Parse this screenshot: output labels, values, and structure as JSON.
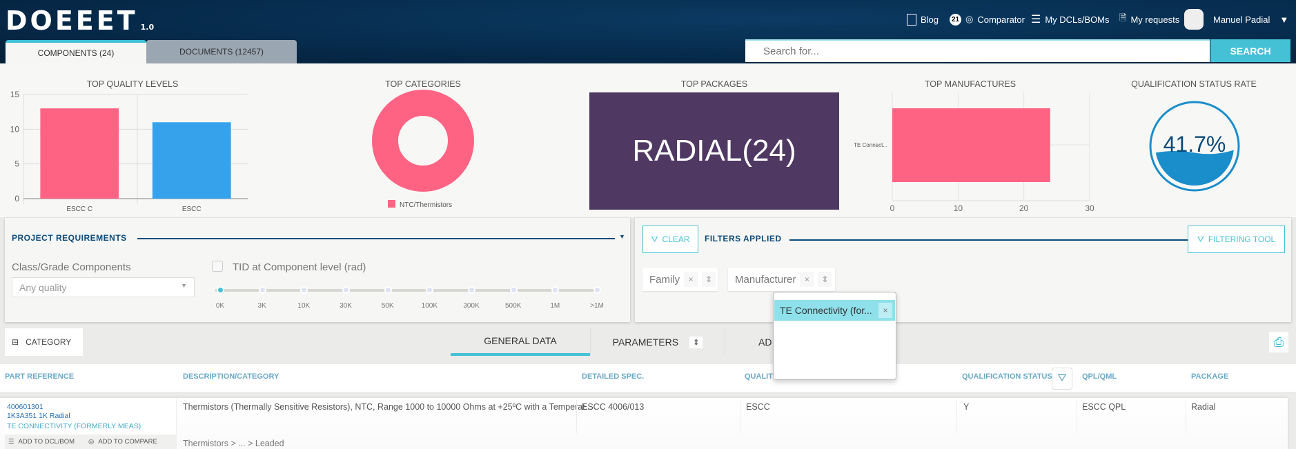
{
  "header": {
    "logo": "DOEEET",
    "version": "1.0",
    "nav": [
      {
        "label": "Blog",
        "icon": "blog-icon"
      },
      {
        "label": "Comparator",
        "badge": "21",
        "icon": "compare-icon"
      },
      {
        "label": "My DCLs/BOMs",
        "icon": "list-icon"
      },
      {
        "label": "My requests",
        "icon": "document-icon"
      }
    ],
    "user": "Manuel Padial"
  },
  "tabs": [
    {
      "label": "COMPONENTS (24)",
      "active": true
    },
    {
      "label": "DOCUMENTS (12457)"
    }
  ],
  "search": {
    "placeholder": "Search for...",
    "button": "SEARCH"
  },
  "colors": {
    "pink": "#ff6384",
    "blue": "#36a2eb",
    "purple": "#4f3862",
    "accent": "#45c1d6",
    "navy": "#0b4a7a",
    "gauge": "#1a8dcb"
  },
  "chart_data": [
    {
      "type": "bar",
      "title": "TOP QUALITY LEVELS",
      "categories": [
        "ESCC C",
        "ESCC"
      ],
      "values": [
        13,
        11
      ],
      "ylim": [
        0,
        15
      ],
      "yticks": [
        "0",
        "5",
        "10",
        "15"
      ],
      "grid": true
    },
    {
      "type": "pie",
      "title": "TOP CATEGORIES",
      "categories": [
        "NTC/Thermistors"
      ],
      "values": [
        24
      ],
      "legend": "bottom",
      "donut": true
    },
    {
      "type": "table",
      "title": "TOP PACKAGES",
      "label": "RADIAL(24)"
    },
    {
      "type": "bar",
      "orientation": "horizontal",
      "title": "TOP MANUFACTURES",
      "categories": [
        "TE Connect..."
      ],
      "values": [
        24
      ],
      "xlim": [
        0,
        30
      ],
      "xticks": [
        "0",
        "10",
        "20",
        "30"
      ],
      "grid": true
    },
    {
      "type": "gauge",
      "title": "QUALIFICATION STATUS RATE",
      "value": 41.7,
      "label": "41.7%"
    }
  ],
  "project": {
    "title": "PROJECT REQUIREMENTS",
    "class_label": "Class/Grade Components",
    "class_value": "Any quality",
    "tid_label": "TID at Component level (rad)",
    "tid_checked": false,
    "slider_labels": [
      "0K",
      "3K",
      "10K",
      "30K",
      "50K",
      "100K",
      "300K",
      "500K",
      "1M",
      ">1M"
    ],
    "slider_value": "0K"
  },
  "filters": {
    "clear": "CLEAR",
    "title": "FILTERS APPLIED",
    "tool": "FILTERING TOOL",
    "chips": [
      "Family",
      "Manufacturer"
    ],
    "dropdown_items": [
      "TE Connectivity (for..."
    ]
  },
  "toolbar": {
    "category": "CATEGORY",
    "tabs": [
      "GENERAL DATA",
      "PARAMETERS",
      "AD"
    ]
  },
  "table": {
    "headers": [
      "PART REFERENCE",
      "DESCRIPTION/CATEGORY",
      "DETAILED SPEC.",
      "QUALITY",
      "QUALIFICATION STATUS",
      "QPL/QML",
      "PACKAGE"
    ],
    "rows": [
      {
        "part": "400601301",
        "part2": "1K3A351 1K Radial",
        "manufacturer": "TE CONNECTIVITY (FORMERLY MEAS)",
        "add_dcl": "ADD TO DCL/BOM",
        "add_compare": "ADD TO COMPARE",
        "description": "Thermistors (Thermally Sensitive Resistors), NTC, Range 1000 to 10000 Ohms at +25ºC with a Temperat...",
        "category_path": "Thermistors > ... > Leaded",
        "spec": "ESCC 4006/013",
        "quality": "ESCC",
        "status": "Y",
        "qpl": "ESCC QPL",
        "package": "Radial"
      }
    ]
  }
}
